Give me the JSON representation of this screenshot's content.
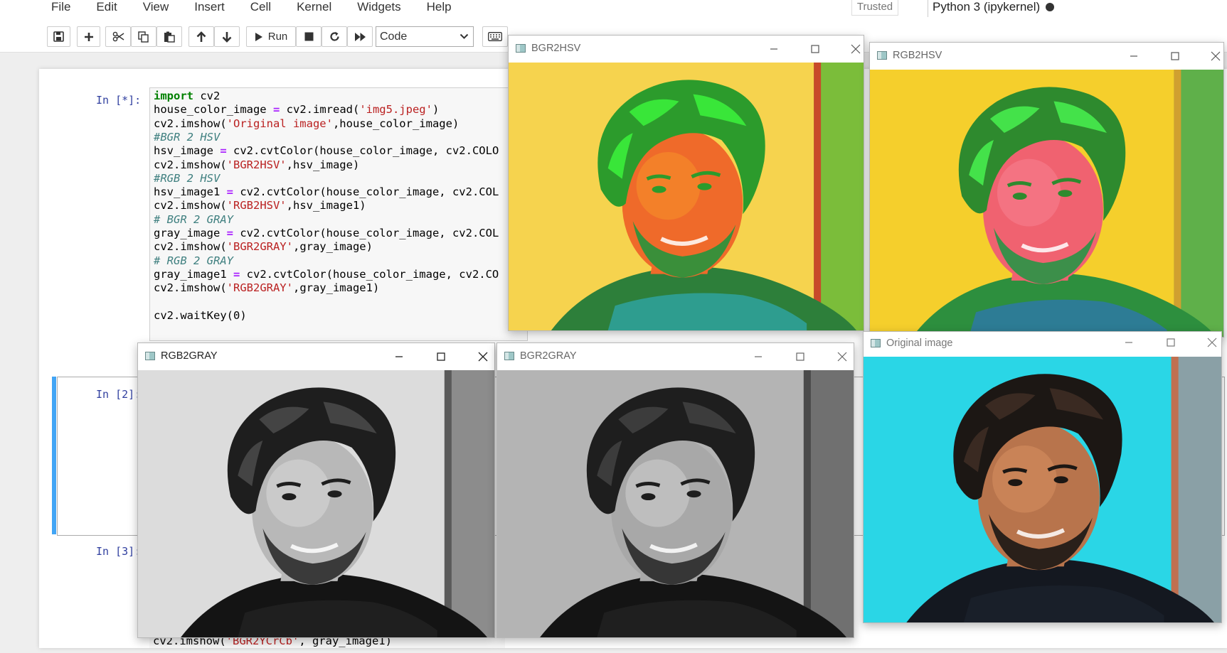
{
  "menubar": {
    "items": [
      "File",
      "Edit",
      "View",
      "Insert",
      "Cell",
      "Kernel",
      "Widgets",
      "Help"
    ]
  },
  "kernel": {
    "trusted": "Trusted",
    "name": "Python 3 (ipykernel)"
  },
  "toolbar": {
    "run_label": "Run",
    "cell_type": "Code",
    "icons": [
      "save-icon",
      "plus-icon",
      "scissors-icon",
      "copy-icon",
      "paste-icon",
      "arrow-up-icon",
      "arrow-down-icon",
      "run-icon",
      "stop-icon",
      "restart-icon",
      "fast-forward-icon",
      "keyboard-icon"
    ]
  },
  "cells": [
    {
      "prompt": "In [*]:",
      "lines": [
        [
          {
            "t": "import",
            "c": "kw"
          },
          {
            "t": " cv2",
            "c": ""
          }
        ],
        [
          {
            "t": "house_color_image ",
            "c": ""
          },
          {
            "t": "=",
            "c": "op"
          },
          {
            "t": " cv2.imread(",
            "c": ""
          },
          {
            "t": "'img5.jpeg'",
            "c": "str"
          },
          {
            "t": ")",
            "c": ""
          }
        ],
        [
          {
            "t": "cv2.imshow(",
            "c": ""
          },
          {
            "t": "'Original image'",
            "c": "str"
          },
          {
            "t": ",house_color_image)",
            "c": ""
          }
        ],
        [
          {
            "t": "#BGR 2 HSV",
            "c": "cmt"
          }
        ],
        [
          {
            "t": "hsv_image ",
            "c": ""
          },
          {
            "t": "=",
            "c": "op"
          },
          {
            "t": " cv2.cvtColor(house_color_image, cv2.COLO",
            "c": ""
          }
        ],
        [
          {
            "t": "cv2.imshow(",
            "c": ""
          },
          {
            "t": "'BGR2HSV'",
            "c": "str"
          },
          {
            "t": ",hsv_image)",
            "c": ""
          }
        ],
        [
          {
            "t": "#RGB 2 HSV",
            "c": "cmt"
          }
        ],
        [
          {
            "t": "hsv_image1 ",
            "c": ""
          },
          {
            "t": "=",
            "c": "op"
          },
          {
            "t": " cv2.cvtColor(house_color_image, cv2.COL",
            "c": ""
          }
        ],
        [
          {
            "t": "cv2.imshow(",
            "c": ""
          },
          {
            "t": "'RGB2HSV'",
            "c": "str"
          },
          {
            "t": ",hsv_image1)",
            "c": ""
          }
        ],
        [
          {
            "t": "# BGR 2 GRAY",
            "c": "cmt"
          }
        ],
        [
          {
            "t": "gray_image ",
            "c": ""
          },
          {
            "t": "=",
            "c": "op"
          },
          {
            "t": " cv2.cvtColor(house_color_image, cv2.COL",
            "c": ""
          }
        ],
        [
          {
            "t": "cv2.imshow(",
            "c": ""
          },
          {
            "t": "'BGR2GRAY'",
            "c": "str"
          },
          {
            "t": ",gray_image)",
            "c": ""
          }
        ],
        [
          {
            "t": "# RGB 2 GRAY",
            "c": "cmt"
          }
        ],
        [
          {
            "t": "gray_image1 ",
            "c": ""
          },
          {
            "t": "=",
            "c": "op"
          },
          {
            "t": " cv2.cvtColor(house_color_image, cv2.CO",
            "c": ""
          }
        ],
        [
          {
            "t": "cv2.imshow(",
            "c": ""
          },
          {
            "t": "'RGB2GRAY'",
            "c": "str"
          },
          {
            "t": ",gray_image1)",
            "c": ""
          }
        ],
        [
          {
            "t": "",
            "c": ""
          }
        ],
        [
          {
            "t": "cv2.waitKey(0)",
            "c": ""
          }
        ]
      ]
    },
    {
      "prompt": "In [2]:"
    },
    {
      "prompt": "In [3]:",
      "bottom_line": [
        {
          "t": "cv2.imshow(",
          "c": ""
        },
        {
          "t": "'BGR2YCrCb'",
          "c": "str"
        },
        {
          "t": ", gray_image1)",
          "c": ""
        }
      ]
    }
  ],
  "windows": [
    {
      "id": "bgr2hsv",
      "title": "BGR2HSV",
      "style": "hsv-bgr"
    },
    {
      "id": "rgb2hsv",
      "title": "RGB2HSV",
      "style": "hsv-rgb"
    },
    {
      "id": "rgb2gray",
      "title": "RGB2GRAY",
      "style": "gray-light"
    },
    {
      "id": "bgr2gray",
      "title": "BGR2GRAY",
      "style": "gray-dark"
    },
    {
      "id": "original",
      "title": "Original image",
      "style": "original"
    }
  ],
  "colors": {
    "selected_cell_bar": "#42a5f5",
    "prompt": "#303f9f"
  }
}
